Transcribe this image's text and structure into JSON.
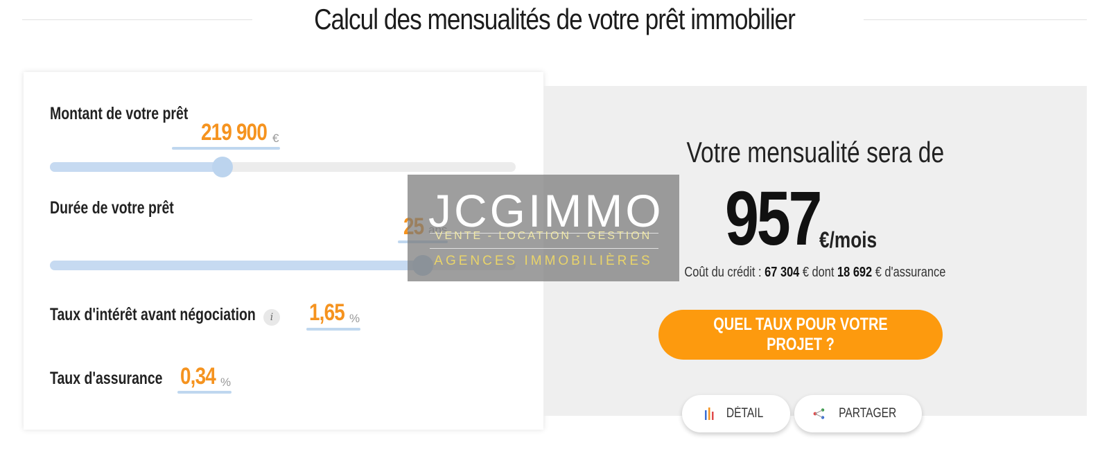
{
  "title": "Calcul des mensualités de votre prêt immobilier",
  "form": {
    "amount": {
      "label": "Montant de votre prêt",
      "value": "219 900",
      "unit": "€",
      "slider_fraction": 0.37
    },
    "duration": {
      "label": "Durée de votre prêt",
      "value": "25",
      "unit": "ans",
      "slider_fraction": 0.8
    },
    "interest": {
      "label": "Taux d'intérêt avant négociation",
      "info_icon": "i",
      "value": "1,65",
      "unit": "%"
    },
    "insurance": {
      "label": "Taux d'assurance",
      "value": "0,34",
      "unit": "%"
    }
  },
  "watermark": {
    "logo": "JCGIMMO",
    "tagline": "VENTE - LOCATION - GESTION",
    "subtitle": "AGENCES IMMOBILIÈRES"
  },
  "result": {
    "label": "Votre mensualité sera de",
    "amount": "957",
    "per": "€/mois",
    "cost_prefix": "Coût du crédit : ",
    "cost_total": "67 304",
    "cost_mid": " € dont ",
    "cost_insurance": "18 692",
    "cost_suffix": " € d'assurance",
    "cta_label": "QUEL TAUX POUR VOTRE PROJET ?",
    "detail_label": "DÉTAIL",
    "share_label": "PARTAGER",
    "detail_icon": "bar-chart-icon",
    "share_icon": "share-icon"
  },
  "colors": {
    "accent": "#f5931f",
    "cta": "#fd9a0e",
    "slider": "#c6daf1",
    "panel": "#efefef"
  }
}
